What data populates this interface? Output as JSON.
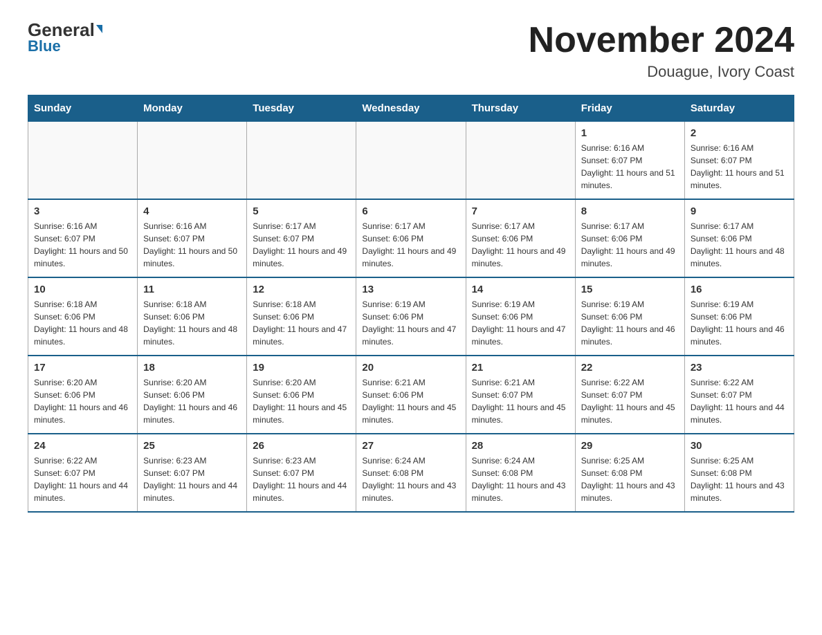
{
  "logo": {
    "general": "General",
    "blue": "Blue",
    "triangle": "▼"
  },
  "title": "November 2024",
  "subtitle": "Douague, Ivory Coast",
  "days_of_week": [
    "Sunday",
    "Monday",
    "Tuesday",
    "Wednesday",
    "Thursday",
    "Friday",
    "Saturday"
  ],
  "weeks": [
    [
      {
        "day": "",
        "info": ""
      },
      {
        "day": "",
        "info": ""
      },
      {
        "day": "",
        "info": ""
      },
      {
        "day": "",
        "info": ""
      },
      {
        "day": "",
        "info": ""
      },
      {
        "day": "1",
        "info": "Sunrise: 6:16 AM\nSunset: 6:07 PM\nDaylight: 11 hours and 51 minutes."
      },
      {
        "day": "2",
        "info": "Sunrise: 6:16 AM\nSunset: 6:07 PM\nDaylight: 11 hours and 51 minutes."
      }
    ],
    [
      {
        "day": "3",
        "info": "Sunrise: 6:16 AM\nSunset: 6:07 PM\nDaylight: 11 hours and 50 minutes."
      },
      {
        "day": "4",
        "info": "Sunrise: 6:16 AM\nSunset: 6:07 PM\nDaylight: 11 hours and 50 minutes."
      },
      {
        "day": "5",
        "info": "Sunrise: 6:17 AM\nSunset: 6:07 PM\nDaylight: 11 hours and 49 minutes."
      },
      {
        "day": "6",
        "info": "Sunrise: 6:17 AM\nSunset: 6:06 PM\nDaylight: 11 hours and 49 minutes."
      },
      {
        "day": "7",
        "info": "Sunrise: 6:17 AM\nSunset: 6:06 PM\nDaylight: 11 hours and 49 minutes."
      },
      {
        "day": "8",
        "info": "Sunrise: 6:17 AM\nSunset: 6:06 PM\nDaylight: 11 hours and 49 minutes."
      },
      {
        "day": "9",
        "info": "Sunrise: 6:17 AM\nSunset: 6:06 PM\nDaylight: 11 hours and 48 minutes."
      }
    ],
    [
      {
        "day": "10",
        "info": "Sunrise: 6:18 AM\nSunset: 6:06 PM\nDaylight: 11 hours and 48 minutes."
      },
      {
        "day": "11",
        "info": "Sunrise: 6:18 AM\nSunset: 6:06 PM\nDaylight: 11 hours and 48 minutes."
      },
      {
        "day": "12",
        "info": "Sunrise: 6:18 AM\nSunset: 6:06 PM\nDaylight: 11 hours and 47 minutes."
      },
      {
        "day": "13",
        "info": "Sunrise: 6:19 AM\nSunset: 6:06 PM\nDaylight: 11 hours and 47 minutes."
      },
      {
        "day": "14",
        "info": "Sunrise: 6:19 AM\nSunset: 6:06 PM\nDaylight: 11 hours and 47 minutes."
      },
      {
        "day": "15",
        "info": "Sunrise: 6:19 AM\nSunset: 6:06 PM\nDaylight: 11 hours and 46 minutes."
      },
      {
        "day": "16",
        "info": "Sunrise: 6:19 AM\nSunset: 6:06 PM\nDaylight: 11 hours and 46 minutes."
      }
    ],
    [
      {
        "day": "17",
        "info": "Sunrise: 6:20 AM\nSunset: 6:06 PM\nDaylight: 11 hours and 46 minutes."
      },
      {
        "day": "18",
        "info": "Sunrise: 6:20 AM\nSunset: 6:06 PM\nDaylight: 11 hours and 46 minutes."
      },
      {
        "day": "19",
        "info": "Sunrise: 6:20 AM\nSunset: 6:06 PM\nDaylight: 11 hours and 45 minutes."
      },
      {
        "day": "20",
        "info": "Sunrise: 6:21 AM\nSunset: 6:06 PM\nDaylight: 11 hours and 45 minutes."
      },
      {
        "day": "21",
        "info": "Sunrise: 6:21 AM\nSunset: 6:07 PM\nDaylight: 11 hours and 45 minutes."
      },
      {
        "day": "22",
        "info": "Sunrise: 6:22 AM\nSunset: 6:07 PM\nDaylight: 11 hours and 45 minutes."
      },
      {
        "day": "23",
        "info": "Sunrise: 6:22 AM\nSunset: 6:07 PM\nDaylight: 11 hours and 44 minutes."
      }
    ],
    [
      {
        "day": "24",
        "info": "Sunrise: 6:22 AM\nSunset: 6:07 PM\nDaylight: 11 hours and 44 minutes."
      },
      {
        "day": "25",
        "info": "Sunrise: 6:23 AM\nSunset: 6:07 PM\nDaylight: 11 hours and 44 minutes."
      },
      {
        "day": "26",
        "info": "Sunrise: 6:23 AM\nSunset: 6:07 PM\nDaylight: 11 hours and 44 minutes."
      },
      {
        "day": "27",
        "info": "Sunrise: 6:24 AM\nSunset: 6:08 PM\nDaylight: 11 hours and 43 minutes."
      },
      {
        "day": "28",
        "info": "Sunrise: 6:24 AM\nSunset: 6:08 PM\nDaylight: 11 hours and 43 minutes."
      },
      {
        "day": "29",
        "info": "Sunrise: 6:25 AM\nSunset: 6:08 PM\nDaylight: 11 hours and 43 minutes."
      },
      {
        "day": "30",
        "info": "Sunrise: 6:25 AM\nSunset: 6:08 PM\nDaylight: 11 hours and 43 minutes."
      }
    ]
  ]
}
